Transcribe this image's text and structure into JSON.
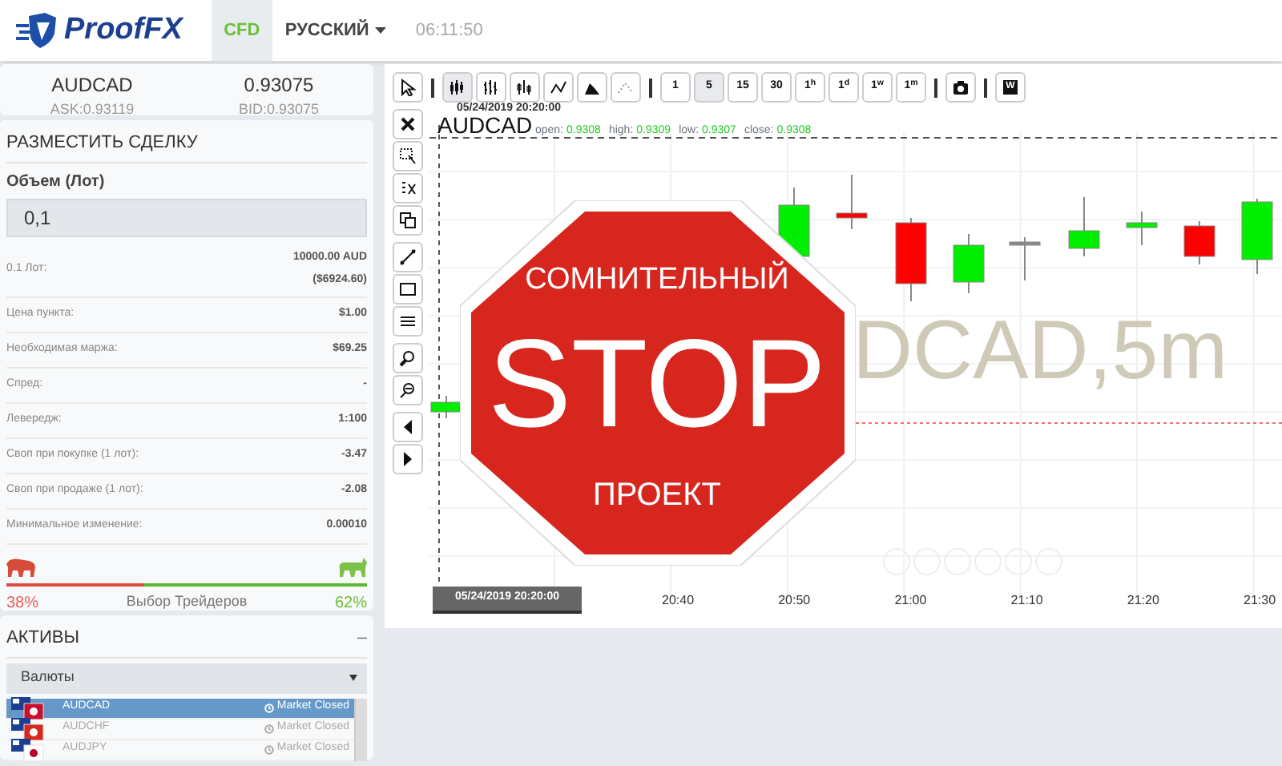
{
  "header": {
    "logo": "ProofFX",
    "tabs": [
      {
        "label": "CFD",
        "selected": true
      }
    ],
    "language": "РУССКИЙ",
    "time": "06:11:50"
  },
  "ticker": {
    "symbol": "AUDCAD",
    "ask": "ASK:0.93119",
    "price": "0.93075",
    "bid": "BID:0.93075"
  },
  "trade": {
    "title": "РАЗМЕСТИТЬ СДЕЛКУ",
    "volume_label": "Объем (Лот)",
    "volume_value": "0,1",
    "rows": [
      {
        "label": "0.1 Лот:",
        "value": "10000.00 AUD",
        "value_2": "($6924.60)"
      },
      {
        "label": "Цена пункта:",
        "value": "$1.00"
      },
      {
        "label": "Необходимая маржа:",
        "value": "$69.25"
      },
      {
        "label": "Спред:",
        "value": "-"
      },
      {
        "label": "Левередж:",
        "value": "1:100"
      },
      {
        "label": "Своп при покупке (1 лот):",
        "value": "-3.47"
      },
      {
        "label": "Своп при продаже (1 лот):",
        "value": "-2.08"
      },
      {
        "label": "Минимальное изменение:",
        "value": "0.00010"
      }
    ],
    "sentiment": {
      "sell": "38%",
      "caption": "Выбор Трейдеров",
      "buy": "62%",
      "level": 0.38
    }
  },
  "assets": {
    "title": "АКТИВЫ",
    "collapse": "–",
    "category": "Валюты",
    "items": [
      {
        "symbol": "AUDCAD",
        "status": "Market Closed",
        "selected": true
      },
      {
        "symbol": "AUDCHF",
        "status": "Market Closed",
        "selected": false
      },
      {
        "symbol": "AUDJPY",
        "status": "Market Closed",
        "selected": false
      }
    ]
  },
  "chart": {
    "chart_types": [
      {
        "selected": true
      },
      {
        "selected": false
      },
      {
        "selected": false
      },
      {
        "selected": false
      },
      {
        "selected": false
      },
      {
        "selected": false
      }
    ],
    "timeframes": [
      {
        "label": "1",
        "selected": false
      },
      {
        "label": "5",
        "selected": true
      },
      {
        "label": "15",
        "selected": false
      },
      {
        "label": "30",
        "selected": false
      },
      {
        "label": "1$^{h}$",
        "selected": false
      },
      {
        "label": "1$^{d}$",
        "selected": false
      },
      {
        "label": "1$^{w}$",
        "selected": false
      },
      {
        "label": "1$^{m}$",
        "selected": false
      }
    ],
    "snapshot_button": "W",
    "date_top": "05/24/2019 20:20:00",
    "symbol": "AUDCAD",
    "ohlc": [
      {
        "label": "open:",
        "value": "0.9308"
      },
      {
        "label": "high:",
        "value": "0.9309"
      },
      {
        "label": "low:",
        "value": "0.9307"
      },
      {
        "label": "close:",
        "value": "0.9308"
      }
    ],
    "watermark": "DCAD,5m",
    "x_labels": [
      "20:40",
      "20:50",
      "21:00",
      "21:10",
      "21:20",
      "21:30"
    ],
    "crosshair_label": "05/24/2019 20:20:00"
  },
  "stop_sign": {
    "line_1": "СОМНИТЕЛЬНЫЙ",
    "line_2": "STOP",
    "line_3": "ПРОЕКТ"
  }
}
